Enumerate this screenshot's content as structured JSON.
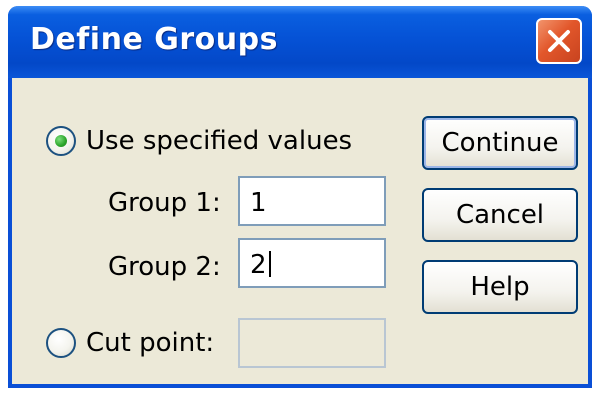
{
  "window": {
    "title": "Define Groups",
    "close_icon": "close-icon"
  },
  "options": {
    "use_specified_values": {
      "label": "Use specified values",
      "selected": true
    },
    "cut_point": {
      "label": "Cut point:",
      "selected": false,
      "value": ""
    }
  },
  "groups": {
    "group1": {
      "label": "Group 1:",
      "value": "1"
    },
    "group2": {
      "label": "Group 2:",
      "value": "2"
    }
  },
  "buttons": {
    "continue": "Continue",
    "cancel": "Cancel",
    "help": "Help"
  },
  "colors": {
    "titlebar": "#0552d6",
    "close_button": "#e2572b",
    "dialog_background": "#ece9d8",
    "radio_selected": "#2aa42a"
  }
}
